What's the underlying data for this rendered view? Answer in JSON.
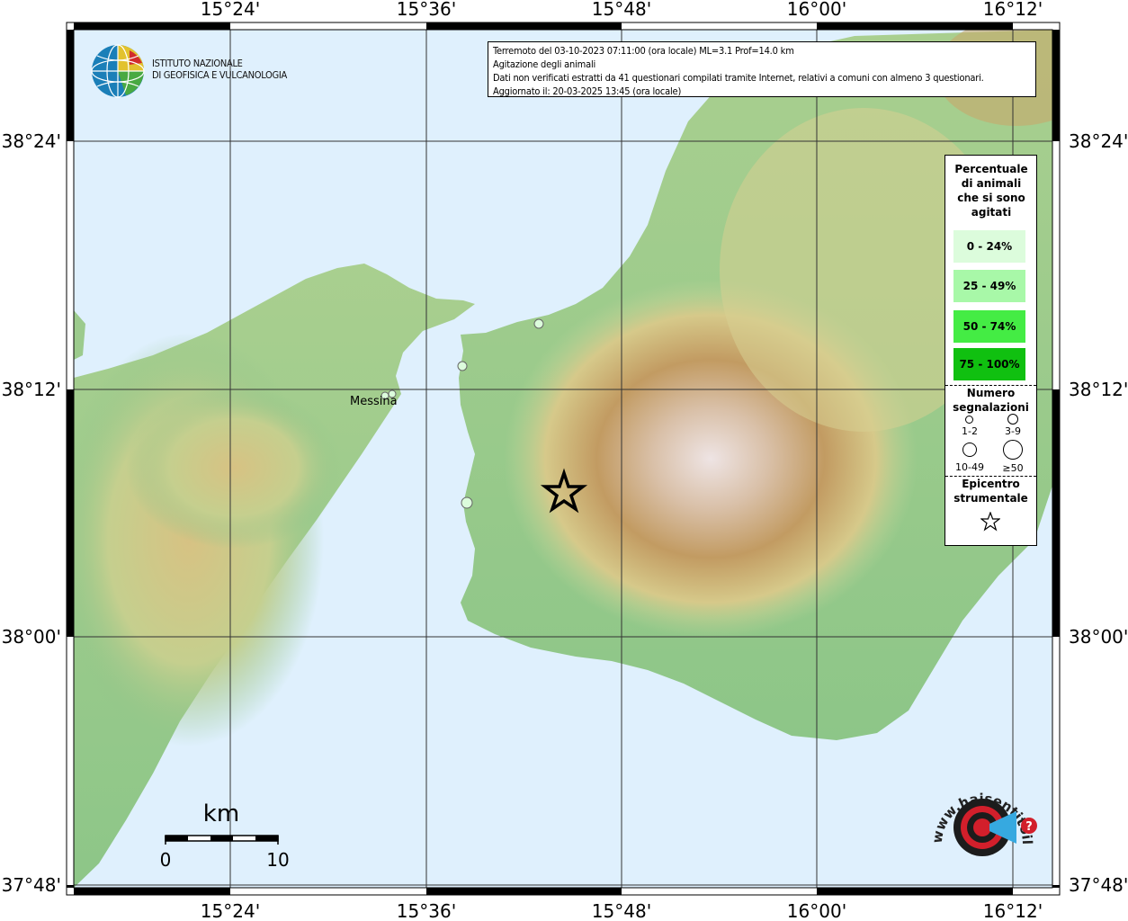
{
  "header": {
    "line1": "Terremoto del 03-10-2023 07:11:00 (ora locale) ML=3.1 Prof=14.0 km",
    "line2": "Agitazione degli animali",
    "line3": "Dati non verificati estratti da 41 questionari compilati tramite Internet, relativi a comuni con almeno 3 questionari.",
    "line4": "Aggiornato il: 20-03-2025 13:45 (ora locale)"
  },
  "logo": {
    "line1": "ISTITUTO NAZIONALE",
    "line2": "DI GEOFISICA E VULCANOLOGIA",
    "icon": "ingv-globe-icon"
  },
  "axes": {
    "top": [
      "15°24'",
      "15°36'",
      "15°48'",
      "16°00'",
      "16°12'"
    ],
    "bottom": [
      "15°24'",
      "15°36'",
      "15°48'",
      "16°00'",
      "16°12'"
    ],
    "left": [
      "38°24'",
      "38°12'",
      "38°00'",
      "37°48'"
    ],
    "right": [
      "38°24'",
      "38°12'",
      "38°00'",
      "37°48'"
    ]
  },
  "places": {
    "messina": "Messina"
  },
  "legend": {
    "title": "Percentuale di animali che si sono agitati",
    "classes": [
      {
        "label": "0 - 24%",
        "color": "#dcfcdc"
      },
      {
        "label": "25 - 49%",
        "color": "#a8f8a8"
      },
      {
        "label": "50 - 74%",
        "color": "#44ec44"
      },
      {
        "label": "75 - 100%",
        "color": "#10c010"
      }
    ],
    "count_title": "Numero segnalazioni",
    "counts": [
      "1-2",
      "3-9",
      "10-49",
      "≥50"
    ],
    "epicenter_title": "Epicentro strumentale"
  },
  "scale": {
    "unit": "km",
    "start": "0",
    "end": "10"
  },
  "brand": {
    "text": "www.haisentitoilterremoto.it",
    "accent": "#d21f2b"
  },
  "colors": {
    "sea": "#dff0fd",
    "lowland": "#8fc48a",
    "hills": "#d8d6a0",
    "mountains": "#b89060",
    "peaks": "#ebe0e0"
  }
}
